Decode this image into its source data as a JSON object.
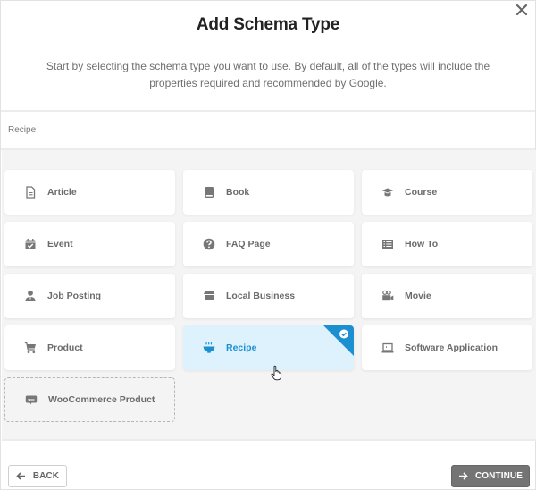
{
  "modal": {
    "title": "Add Schema Type",
    "description": "Start by selecting the schema type you want to use. By default, all of the types will include the properties required and recommended by Google.",
    "close_icon": "close-icon"
  },
  "search": {
    "value": "Recipe",
    "placeholder": "Recipe"
  },
  "schema_types": [
    {
      "label": "Article",
      "icon": "document-icon",
      "state": "default"
    },
    {
      "label": "Book",
      "icon": "book-icon",
      "state": "default"
    },
    {
      "label": "Course",
      "icon": "graduation-cap-icon",
      "state": "default"
    },
    {
      "label": "Event",
      "icon": "calendar-check-icon",
      "state": "default"
    },
    {
      "label": "FAQ Page",
      "icon": "question-circle-icon",
      "state": "default"
    },
    {
      "label": "How To",
      "icon": "list-icon",
      "state": "default"
    },
    {
      "label": "Job Posting",
      "icon": "user-tie-icon",
      "state": "default"
    },
    {
      "label": "Local Business",
      "icon": "store-icon",
      "state": "default"
    },
    {
      "label": "Movie",
      "icon": "video-camera-icon",
      "state": "default"
    },
    {
      "label": "Product",
      "icon": "cart-icon",
      "state": "default"
    },
    {
      "label": "Recipe",
      "icon": "bowl-icon",
      "state": "selected"
    },
    {
      "label": "Software Application",
      "icon": "laptop-icon",
      "state": "default"
    },
    {
      "label": "WooCommerce Product",
      "icon": "woo-icon",
      "state": "disabled"
    }
  ],
  "colors": {
    "accent": "#1c8fd1",
    "selected_bg": "#ddf2fd",
    "continue_bg": "#747474"
  },
  "footer": {
    "back_label": "BACK",
    "continue_label": "CONTINUE"
  }
}
